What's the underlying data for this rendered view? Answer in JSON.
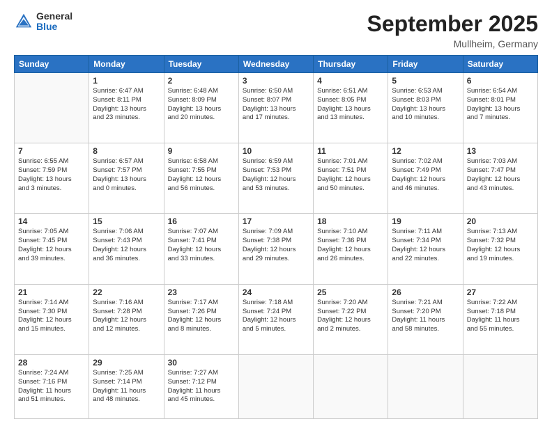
{
  "header": {
    "logo": {
      "general": "General",
      "blue": "Blue"
    },
    "title": "September 2025",
    "location": "Mullheim, Germany"
  },
  "days_of_week": [
    "Sunday",
    "Monday",
    "Tuesday",
    "Wednesday",
    "Thursday",
    "Friday",
    "Saturday"
  ],
  "weeks": [
    [
      {
        "day": "",
        "detail": ""
      },
      {
        "day": "1",
        "detail": "Sunrise: 6:47 AM\nSunset: 8:11 PM\nDaylight: 13 hours\nand 23 minutes."
      },
      {
        "day": "2",
        "detail": "Sunrise: 6:48 AM\nSunset: 8:09 PM\nDaylight: 13 hours\nand 20 minutes."
      },
      {
        "day": "3",
        "detail": "Sunrise: 6:50 AM\nSunset: 8:07 PM\nDaylight: 13 hours\nand 17 minutes."
      },
      {
        "day": "4",
        "detail": "Sunrise: 6:51 AM\nSunset: 8:05 PM\nDaylight: 13 hours\nand 13 minutes."
      },
      {
        "day": "5",
        "detail": "Sunrise: 6:53 AM\nSunset: 8:03 PM\nDaylight: 13 hours\nand 10 minutes."
      },
      {
        "day": "6",
        "detail": "Sunrise: 6:54 AM\nSunset: 8:01 PM\nDaylight: 13 hours\nand 7 minutes."
      }
    ],
    [
      {
        "day": "7",
        "detail": "Sunrise: 6:55 AM\nSunset: 7:59 PM\nDaylight: 13 hours\nand 3 minutes."
      },
      {
        "day": "8",
        "detail": "Sunrise: 6:57 AM\nSunset: 7:57 PM\nDaylight: 13 hours\nand 0 minutes."
      },
      {
        "day": "9",
        "detail": "Sunrise: 6:58 AM\nSunset: 7:55 PM\nDaylight: 12 hours\nand 56 minutes."
      },
      {
        "day": "10",
        "detail": "Sunrise: 6:59 AM\nSunset: 7:53 PM\nDaylight: 12 hours\nand 53 minutes."
      },
      {
        "day": "11",
        "detail": "Sunrise: 7:01 AM\nSunset: 7:51 PM\nDaylight: 12 hours\nand 50 minutes."
      },
      {
        "day": "12",
        "detail": "Sunrise: 7:02 AM\nSunset: 7:49 PM\nDaylight: 12 hours\nand 46 minutes."
      },
      {
        "day": "13",
        "detail": "Sunrise: 7:03 AM\nSunset: 7:47 PM\nDaylight: 12 hours\nand 43 minutes."
      }
    ],
    [
      {
        "day": "14",
        "detail": "Sunrise: 7:05 AM\nSunset: 7:45 PM\nDaylight: 12 hours\nand 39 minutes."
      },
      {
        "day": "15",
        "detail": "Sunrise: 7:06 AM\nSunset: 7:43 PM\nDaylight: 12 hours\nand 36 minutes."
      },
      {
        "day": "16",
        "detail": "Sunrise: 7:07 AM\nSunset: 7:41 PM\nDaylight: 12 hours\nand 33 minutes."
      },
      {
        "day": "17",
        "detail": "Sunrise: 7:09 AM\nSunset: 7:38 PM\nDaylight: 12 hours\nand 29 minutes."
      },
      {
        "day": "18",
        "detail": "Sunrise: 7:10 AM\nSunset: 7:36 PM\nDaylight: 12 hours\nand 26 minutes."
      },
      {
        "day": "19",
        "detail": "Sunrise: 7:11 AM\nSunset: 7:34 PM\nDaylight: 12 hours\nand 22 minutes."
      },
      {
        "day": "20",
        "detail": "Sunrise: 7:13 AM\nSunset: 7:32 PM\nDaylight: 12 hours\nand 19 minutes."
      }
    ],
    [
      {
        "day": "21",
        "detail": "Sunrise: 7:14 AM\nSunset: 7:30 PM\nDaylight: 12 hours\nand 15 minutes."
      },
      {
        "day": "22",
        "detail": "Sunrise: 7:16 AM\nSunset: 7:28 PM\nDaylight: 12 hours\nand 12 minutes."
      },
      {
        "day": "23",
        "detail": "Sunrise: 7:17 AM\nSunset: 7:26 PM\nDaylight: 12 hours\nand 8 minutes."
      },
      {
        "day": "24",
        "detail": "Sunrise: 7:18 AM\nSunset: 7:24 PM\nDaylight: 12 hours\nand 5 minutes."
      },
      {
        "day": "25",
        "detail": "Sunrise: 7:20 AM\nSunset: 7:22 PM\nDaylight: 12 hours\nand 2 minutes."
      },
      {
        "day": "26",
        "detail": "Sunrise: 7:21 AM\nSunset: 7:20 PM\nDaylight: 11 hours\nand 58 minutes."
      },
      {
        "day": "27",
        "detail": "Sunrise: 7:22 AM\nSunset: 7:18 PM\nDaylight: 11 hours\nand 55 minutes."
      }
    ],
    [
      {
        "day": "28",
        "detail": "Sunrise: 7:24 AM\nSunset: 7:16 PM\nDaylight: 11 hours\nand 51 minutes."
      },
      {
        "day": "29",
        "detail": "Sunrise: 7:25 AM\nSunset: 7:14 PM\nDaylight: 11 hours\nand 48 minutes."
      },
      {
        "day": "30",
        "detail": "Sunrise: 7:27 AM\nSunset: 7:12 PM\nDaylight: 11 hours\nand 45 minutes."
      },
      {
        "day": "",
        "detail": ""
      },
      {
        "day": "",
        "detail": ""
      },
      {
        "day": "",
        "detail": ""
      },
      {
        "day": "",
        "detail": ""
      }
    ]
  ]
}
